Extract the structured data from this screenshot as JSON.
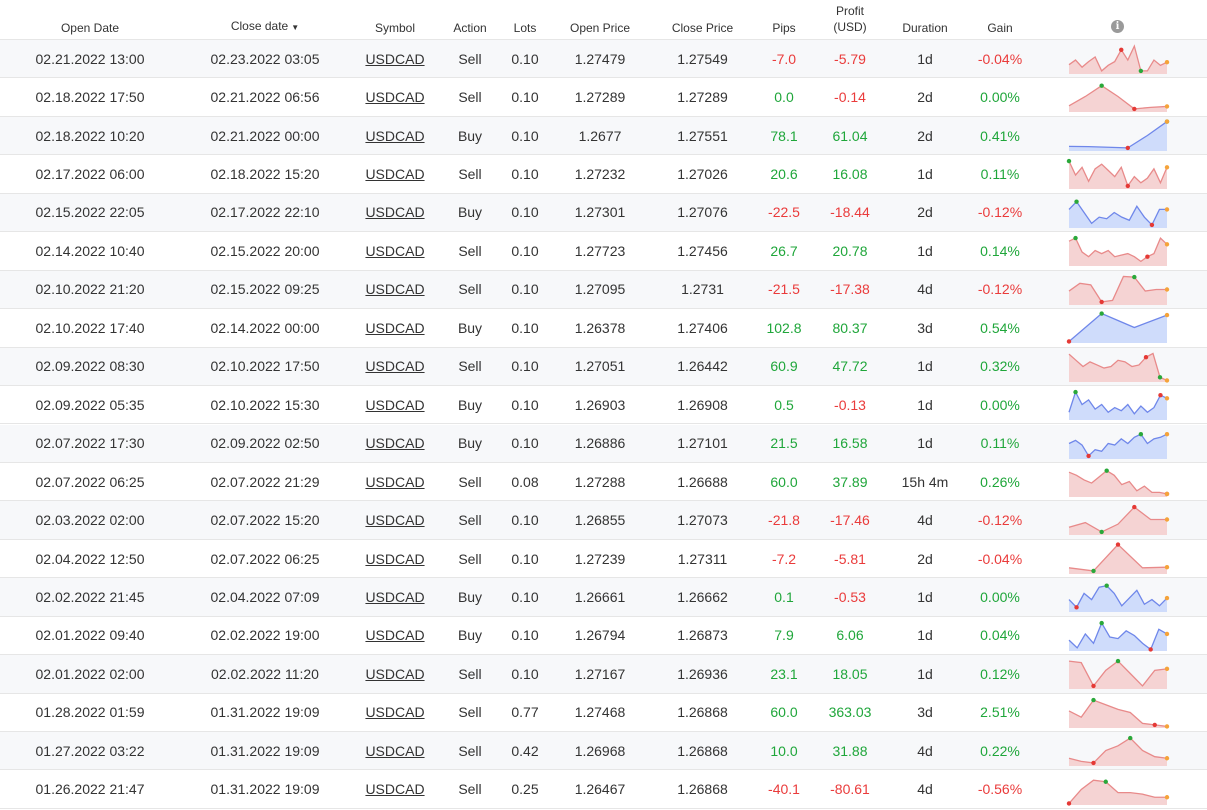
{
  "header": {
    "open_date": "Open Date",
    "close_date": "Close date",
    "sort_arrow": "▼",
    "symbol": "Symbol",
    "action": "Action",
    "lots": "Lots",
    "open_price": "Open Price",
    "close_price": "Close Price",
    "pips": "Pips",
    "profit_line1": "Profit",
    "profit_line2": "(USD)",
    "duration": "Duration",
    "gain": "Gain",
    "info_icon": "i"
  },
  "colors": {
    "positive": "#1fa63a",
    "negative": "#ea3b3b",
    "sell_fill": "#f5d3d3",
    "sell_line": "#e88a8a",
    "buy_fill": "#cfdcfb",
    "buy_line": "#6f87ea"
  },
  "trades": [
    {
      "open": "02.21.2022 13:00",
      "close": "02.23.2022 03:05",
      "symbol": "USDCAD",
      "action": "Sell",
      "lots": "0.10",
      "open_price": "1.27479",
      "close_price": "1.27549",
      "pips": "-7.0",
      "profit": "-5.79",
      "duration": "1d",
      "gain": "-0.04%",
      "spark": [
        0.7,
        0.55,
        0.78,
        0.6,
        0.45,
        0.9,
        0.72,
        0.6,
        0.22,
        0.55,
        0.1,
        0.9,
        0.9,
        0.55,
        0.72,
        0.62
      ],
      "max_i": 11,
      "min_i": 8
    },
    {
      "open": "02.18.2022 17:50",
      "close": "02.21.2022 06:56",
      "symbol": "USDCAD",
      "action": "Sell",
      "lots": "0.10",
      "open_price": "1.27289",
      "close_price": "1.27289",
      "pips": "0.0",
      "profit": "-0.14",
      "duration": "2d",
      "gain": "0.00%",
      "spark": [
        0.8,
        0.5,
        0.15,
        0.5,
        0.9,
        0.85,
        0.82
      ],
      "max_i": 2,
      "min_i": 4
    },
    {
      "open": "02.18.2022 10:20",
      "close": "02.21.2022 00:00",
      "symbol": "USDCAD",
      "action": "Buy",
      "lots": "0.10",
      "open_price": "1.2677",
      "close_price": "1.27551",
      "pips": "78.1",
      "profit": "61.04",
      "duration": "2d",
      "gain": "0.41%",
      "spark": [
        0.85,
        0.86,
        0.88,
        0.9,
        0.5,
        0.05
      ],
      "max_i": 5,
      "min_i": 3
    },
    {
      "open": "02.17.2022 06:00",
      "close": "02.18.2022 15:20",
      "symbol": "USDCAD",
      "action": "Sell",
      "lots": "0.10",
      "open_price": "1.27232",
      "close_price": "1.27026",
      "pips": "20.6",
      "profit": "16.08",
      "duration": "1d",
      "gain": "0.11%",
      "spark": [
        0.1,
        0.55,
        0.3,
        0.75,
        0.35,
        0.2,
        0.4,
        0.6,
        0.3,
        0.9,
        0.6,
        0.8,
        0.65,
        0.35,
        0.8,
        0.3
      ],
      "max_i": 0,
      "min_i": 9
    },
    {
      "open": "02.15.2022 22:05",
      "close": "02.17.2022 22:10",
      "symbol": "USDCAD",
      "action": "Buy",
      "lots": "0.10",
      "open_price": "1.27301",
      "close_price": "1.27076",
      "pips": "-22.5",
      "profit": "-18.44",
      "duration": "2d",
      "gain": "-0.12%",
      "spark": [
        0.4,
        0.15,
        0.5,
        0.85,
        0.65,
        0.7,
        0.5,
        0.65,
        0.75,
        0.3,
        0.65,
        0.9,
        0.4,
        0.4
      ],
      "max_i": 1,
      "min_i": 11
    },
    {
      "open": "02.14.2022 10:40",
      "close": "02.15.2022 20:00",
      "symbol": "USDCAD",
      "action": "Sell",
      "lots": "0.10",
      "open_price": "1.27723",
      "close_price": "1.27456",
      "pips": "26.7",
      "profit": "20.78",
      "duration": "1d",
      "gain": "0.14%",
      "spark": [
        0.2,
        0.1,
        0.55,
        0.7,
        0.5,
        0.6,
        0.5,
        0.7,
        0.65,
        0.6,
        0.7,
        0.85,
        0.7,
        0.6,
        0.1,
        0.3
      ],
      "max_i": 1,
      "min_i": 12
    },
    {
      "open": "02.10.2022 21:20",
      "close": "02.15.2022 09:25",
      "symbol": "USDCAD",
      "action": "Sell",
      "lots": "0.10",
      "open_price": "1.27095",
      "close_price": "1.2731",
      "pips": "-21.5",
      "profit": "-17.38",
      "duration": "4d",
      "gain": "-0.12%",
      "spark": [
        0.55,
        0.3,
        0.35,
        0.9,
        0.85,
        0.08,
        0.1,
        0.55,
        0.5,
        0.5
      ],
      "max_i": 6,
      "min_i": 3
    },
    {
      "open": "02.10.2022 17:40",
      "close": "02.14.2022 00:00",
      "symbol": "USDCAD",
      "action": "Buy",
      "lots": "0.10",
      "open_price": "1.26378",
      "close_price": "1.27406",
      "pips": "102.8",
      "profit": "80.37",
      "duration": "3d",
      "gain": "0.54%",
      "spark": [
        0.95,
        0.05,
        0.5,
        0.1
      ],
      "max_i": 1,
      "min_i": 0
    },
    {
      "open": "02.09.2022 08:30",
      "close": "02.10.2022 17:50",
      "symbol": "USDCAD",
      "action": "Sell",
      "lots": "0.10",
      "open_price": "1.27051",
      "close_price": "1.26442",
      "pips": "60.9",
      "profit": "47.72",
      "duration": "1d",
      "gain": "0.32%",
      "spark": [
        0.1,
        0.3,
        0.5,
        0.35,
        0.45,
        0.55,
        0.5,
        0.3,
        0.35,
        0.5,
        0.45,
        0.2,
        0.08,
        0.85,
        0.95
      ],
      "max_i": 13,
      "min_i": 11
    },
    {
      "open": "02.09.2022 05:35",
      "close": "02.10.2022 15:30",
      "symbol": "USDCAD",
      "action": "Buy",
      "lots": "0.10",
      "open_price": "1.26903",
      "close_price": "1.26908",
      "pips": "0.5",
      "profit": "-0.13",
      "duration": "1d",
      "gain": "0.00%",
      "spark": [
        0.75,
        0.1,
        0.5,
        0.35,
        0.65,
        0.5,
        0.75,
        0.6,
        0.7,
        0.5,
        0.8,
        0.55,
        0.75,
        0.6,
        0.2,
        0.3
      ],
      "max_i": 1,
      "min_i": 14
    },
    {
      "open": "02.07.2022 17:30",
      "close": "02.09.2022 02:50",
      "symbol": "USDCAD",
      "action": "Buy",
      "lots": "0.10",
      "open_price": "1.26886",
      "close_price": "1.27101",
      "pips": "21.5",
      "profit": "16.58",
      "duration": "1d",
      "gain": "0.11%",
      "spark": [
        0.5,
        0.4,
        0.55,
        0.9,
        0.7,
        0.75,
        0.5,
        0.55,
        0.35,
        0.5,
        0.3,
        0.2,
        0.5,
        0.35,
        0.3,
        0.2
      ],
      "max_i": 11,
      "min_i": 3
    },
    {
      "open": "02.07.2022 06:25",
      "close": "02.07.2022 21:29",
      "symbol": "USDCAD",
      "action": "Sell",
      "lots": "0.08",
      "open_price": "1.27288",
      "close_price": "1.26688",
      "pips": "60.0",
      "profit": "37.89",
      "duration": "15h 4m",
      "gain": "0.26%",
      "spark": [
        0.2,
        0.3,
        0.45,
        0.55,
        0.35,
        0.15,
        0.3,
        0.6,
        0.5,
        0.8,
        0.65,
        0.85,
        0.85,
        0.9
      ],
      "max_i": 5,
      "min_i": 13
    },
    {
      "open": "02.03.2022 02:00",
      "close": "02.07.2022 15:20",
      "symbol": "USDCAD",
      "action": "Sell",
      "lots": "0.10",
      "open_price": "1.26855",
      "close_price": "1.27073",
      "pips": "-21.8",
      "profit": "-17.46",
      "duration": "4d",
      "gain": "-0.12%",
      "spark": [
        0.75,
        0.6,
        0.9,
        0.65,
        0.1,
        0.5,
        0.5
      ],
      "max_i": 2,
      "min_i": 4
    },
    {
      "open": "02.04.2022 12:50",
      "close": "02.07.2022 06:25",
      "symbol": "USDCAD",
      "action": "Sell",
      "lots": "0.10",
      "open_price": "1.27239",
      "close_price": "1.27311",
      "pips": "-7.2",
      "profit": "-5.81",
      "duration": "2d",
      "gain": "-0.04%",
      "spark": [
        0.8,
        0.9,
        0.05,
        0.8,
        0.78
      ],
      "max_i": 1,
      "min_i": 2
    },
    {
      "open": "02.02.2022 21:45",
      "close": "02.04.2022 07:09",
      "symbol": "USDCAD",
      "action": "Buy",
      "lots": "0.10",
      "open_price": "1.26661",
      "close_price": "1.26662",
      "pips": "0.1",
      "profit": "-0.53",
      "duration": "1d",
      "gain": "0.00%",
      "spark": [
        0.6,
        0.85,
        0.4,
        0.6,
        0.2,
        0.15,
        0.4,
        0.8,
        0.55,
        0.3,
        0.75,
        0.6,
        0.8,
        0.55
      ],
      "max_i": 5,
      "min_i": 1
    },
    {
      "open": "02.01.2022 09:40",
      "close": "02.02.2022 19:00",
      "symbol": "USDCAD",
      "action": "Buy",
      "lots": "0.10",
      "open_price": "1.26794",
      "close_price": "1.26873",
      "pips": "7.9",
      "profit": "6.06",
      "duration": "1d",
      "gain": "0.04%",
      "spark": [
        0.65,
        0.9,
        0.45,
        0.75,
        0.1,
        0.55,
        0.6,
        0.35,
        0.5,
        0.75,
        0.95,
        0.3,
        0.45
      ],
      "max_i": 4,
      "min_i": 10
    },
    {
      "open": "02.01.2022 02:00",
      "close": "02.02.2022 11:20",
      "symbol": "USDCAD",
      "action": "Sell",
      "lots": "0.10",
      "open_price": "1.27167",
      "close_price": "1.26936",
      "pips": "23.1",
      "profit": "18.05",
      "duration": "1d",
      "gain": "0.12%",
      "spark": [
        0.1,
        0.15,
        0.9,
        0.4,
        0.1,
        0.5,
        0.9,
        0.4,
        0.35
      ],
      "max_i": 4,
      "min_i": 2
    },
    {
      "open": "01.28.2022 01:59",
      "close": "01.31.2022 19:09",
      "symbol": "USDCAD",
      "action": "Sell",
      "lots": "0.77",
      "open_price": "1.27468",
      "close_price": "1.26868",
      "pips": "60.0",
      "profit": "363.03",
      "duration": "3d",
      "gain": "2.51%",
      "spark": [
        0.45,
        0.65,
        0.1,
        0.25,
        0.4,
        0.5,
        0.85,
        0.9,
        0.95
      ],
      "max_i": 2,
      "min_i": 7
    },
    {
      "open": "01.27.2022 03:22",
      "close": "01.31.2022 19:09",
      "symbol": "USDCAD",
      "action": "Sell",
      "lots": "0.42",
      "open_price": "1.26968",
      "close_price": "1.26868",
      "pips": "10.0",
      "profit": "31.88",
      "duration": "4d",
      "gain": "0.22%",
      "spark": [
        0.75,
        0.85,
        0.9,
        0.5,
        0.35,
        0.1,
        0.5,
        0.7,
        0.75
      ],
      "max_i": 5,
      "min_i": 2
    },
    {
      "open": "01.26.2022 21:47",
      "close": "01.31.2022 19:09",
      "symbol": "USDCAD",
      "action": "Sell",
      "lots": "0.25",
      "open_price": "1.26467",
      "close_price": "1.26868",
      "pips": "-40.1",
      "profit": "-80.61",
      "duration": "4d",
      "gain": "-0.56%",
      "spark": [
        0.95,
        0.5,
        0.2,
        0.25,
        0.6,
        0.6,
        0.65,
        0.75,
        0.75
      ],
      "max_i": 3,
      "min_i": 0
    }
  ]
}
